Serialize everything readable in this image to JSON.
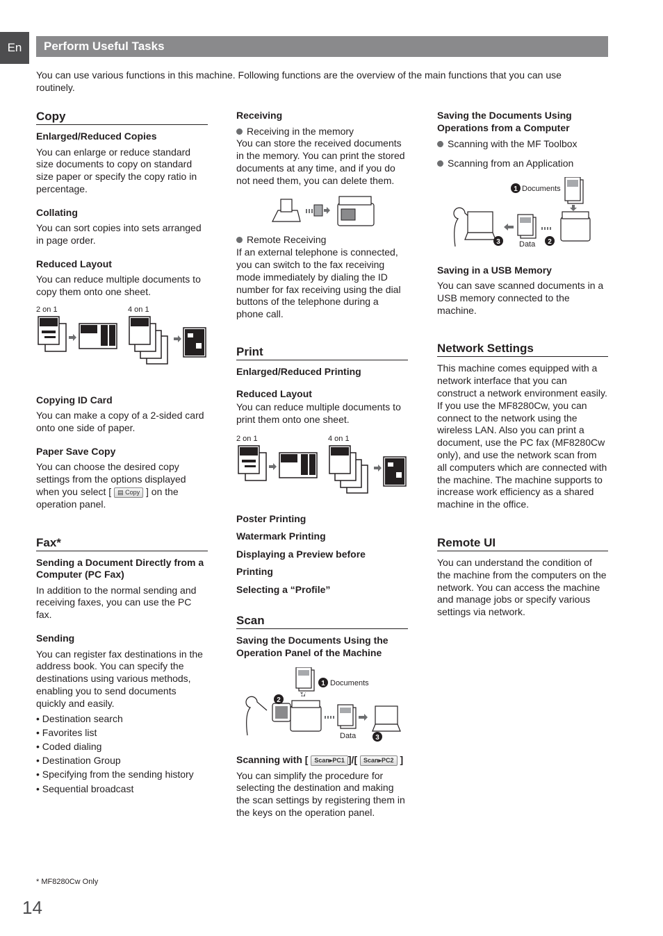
{
  "lang_tab": "En",
  "title": "Perform Useful Tasks",
  "intro": "You can use various functions in this machine. Following functions are the overview of the main functions that you can use routinely.",
  "copy": {
    "title": "Copy",
    "enlarged": {
      "heading": "Enlarged/Reduced Copies",
      "text": "You can enlarge or reduce standard size documents to copy on standard size paper or specify the copy ratio in percentage."
    },
    "collating": {
      "heading": "Collating",
      "text": "You can sort copies into sets arranged in page order."
    },
    "reduced_layout": {
      "heading": "Reduced Layout",
      "text": "You can reduce multiple documents to copy them onto one sheet.",
      "label_2on1": "2 on 1",
      "label_4on1": "4 on 1"
    },
    "id_card": {
      "heading": "Copying ID Card",
      "text": "You can make a copy of a 2-sided card onto one side of paper."
    },
    "paper_save": {
      "heading": "Paper Save Copy",
      "text_before": "You can choose the desired copy settings from the options displayed when you select [",
      "key_label": "Copy",
      "text_after": "] on the operation panel."
    }
  },
  "fax": {
    "title": "Fax*",
    "pc_fax": {
      "heading": "Sending a Document Directly from a Computer (PC Fax)",
      "text": "In addition to the normal sending and receiving faxes, you can use the PC fax."
    },
    "sending": {
      "heading": "Sending",
      "text": "You can register fax destinations in the address book. You can specify the destinations using various methods, enabling you to send documents quickly and easily.",
      "items": [
        "Destination search",
        "Favorites list",
        "Coded dialing",
        "Destination Group",
        "Specifying from the sending history",
        "Sequential broadcast"
      ]
    },
    "receiving": {
      "heading": "Receiving",
      "memory_bullet": "Receiving in the memory",
      "memory_text": "You can store the received documents in the memory. You can print the stored documents at any time, and if you do not need them, you can delete them.",
      "remote_bullet": "Remote Receiving",
      "remote_text": "If an external telephone is connected, you can switch to the fax receiving mode immediately by dialing the ID number for fax receiving using the dial buttons of the telephone during a phone call."
    }
  },
  "print": {
    "title": "Print",
    "enlarged": "Enlarged/Reduced Printing",
    "reduced_layout": {
      "heading": "Reduced Layout",
      "text": "You can reduce multiple documents to print them onto one sheet.",
      "label_2on1": "2 on 1",
      "label_4on1": "4 on 1"
    },
    "items": [
      "Poster Printing",
      "Watermark Printing",
      "Displaying a Preview before",
      "Printing",
      "Selecting a “Profile”"
    ]
  },
  "scan": {
    "title": "Scan",
    "panel": {
      "heading": "Saving the Documents Using the Operation Panel of the Machine",
      "documents_label": "Documents",
      "data_label": "Data",
      "step1": "1",
      "step2": "2",
      "step3": "3"
    },
    "keys": {
      "heading_prefix": "Scanning with [",
      "key1": "Scan▸PC1",
      "mid": "]/[",
      "key2": "Scan▸PC2",
      "suffix": "]",
      "text": "You can simplify the procedure for selecting the destination and making the scan settings by registering them in the keys on the operation panel."
    },
    "computer": {
      "heading": "Saving the Documents Using Operations from a Computer",
      "bullets": [
        "Scanning with the MF Toolbox",
        "Scanning from an Application"
      ],
      "documents_label": "Documents",
      "data_label": "Data",
      "step1": "1",
      "step2": "2",
      "step3": "3"
    },
    "usb": {
      "heading": "Saving in a USB Memory",
      "text": "You can save scanned documents in a USB memory connected to the machine."
    }
  },
  "network": {
    "title": "Network Settings",
    "text": "This machine comes equipped with a network interface that you can construct a network environment easily. If you use the MF8280Cw, you can connect to the network using the wireless LAN. Also you can print a document, use the PC fax (MF8280Cw only), and use the network scan from all computers which are connected with the machine. The machine supports to increase work efficiency as a shared machine in the office."
  },
  "remote_ui": {
    "title": "Remote UI",
    "text": "You can understand the condition of the machine from the computers on the network. You can access the machine and manage jobs or specify various settings via network."
  },
  "footnote": "* MF8280Cw Only",
  "page_number": "14"
}
